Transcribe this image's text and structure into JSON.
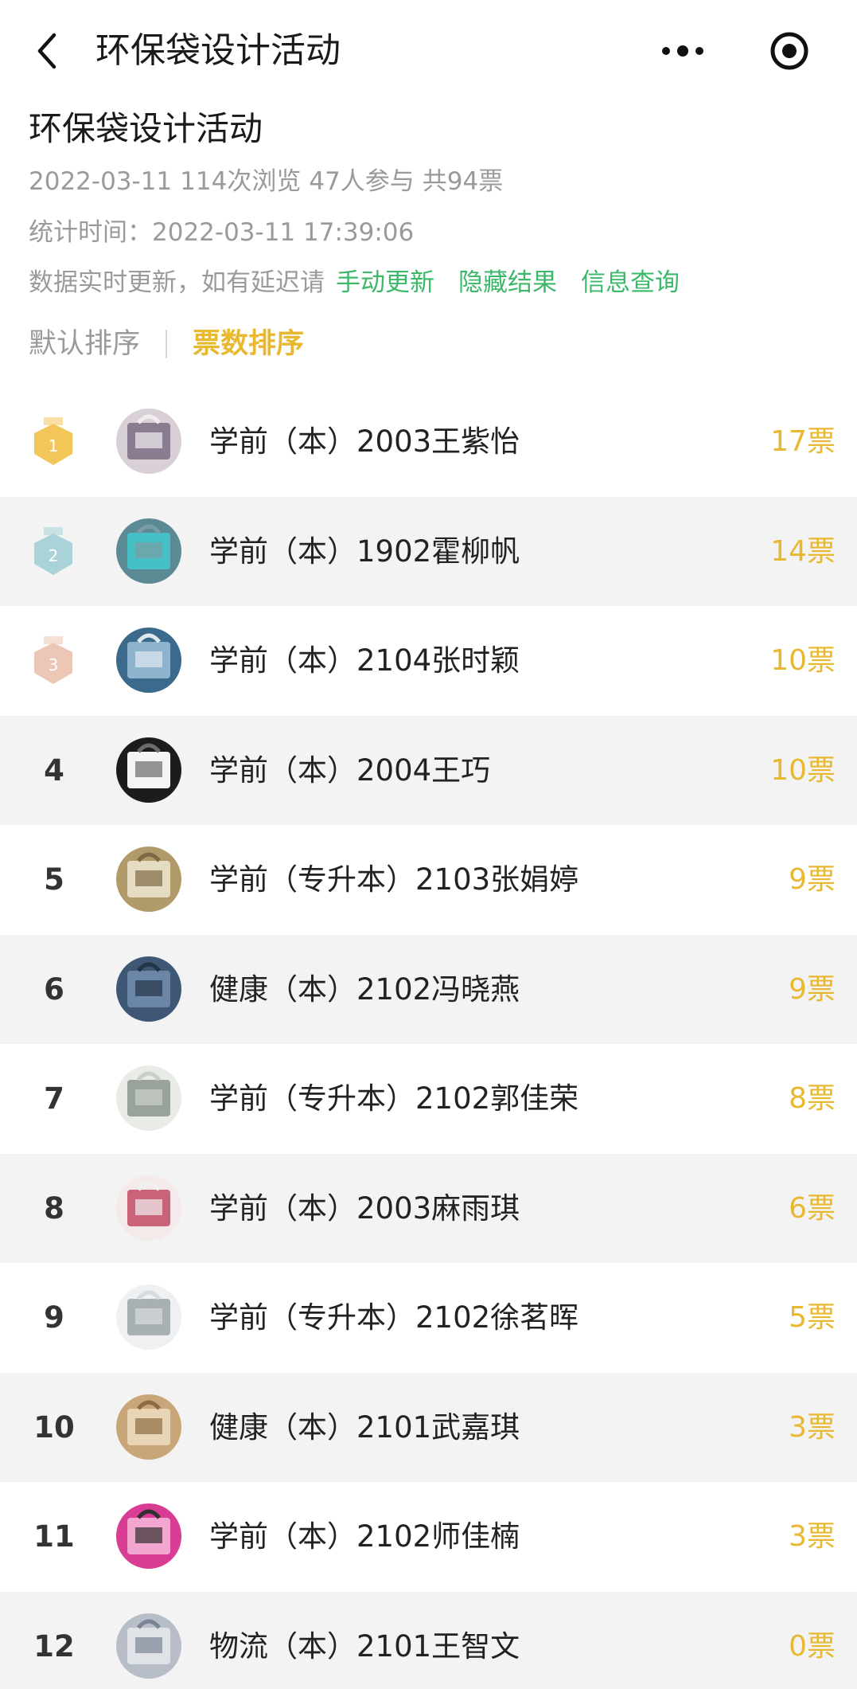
{
  "navbar": {
    "title": "环保袋设计活动",
    "back_icon": "back-chevron-icon",
    "more_icon": "more-dots-icon",
    "miniapp_icon": "target-circle-icon"
  },
  "activity": {
    "title": "环保袋设计活动",
    "date": "2022-03-11",
    "views": "114次浏览",
    "participants": "47人参与",
    "total_votes": "共94票",
    "stat_time": "统计时间：2022-03-11 17:39:06",
    "notice_text": "数据实时更新，如有延迟请",
    "links": {
      "refresh": "手动更新",
      "hide": "隐藏结果",
      "query": "信息查询"
    }
  },
  "sort": {
    "default_label": "默认排序",
    "votes_label": "票数排序"
  },
  "colors": {
    "accent": "#e8b830",
    "link": "#3db86a",
    "gold": "#f3c65a",
    "silver": "#a9d3d8",
    "bronze": "#ecc7b5"
  },
  "ranking": [
    {
      "rank": "1",
      "name": "学前（本）2003王紫怡",
      "votes": "17票",
      "medal": "gold"
    },
    {
      "rank": "2",
      "name": "学前（本）1902霍柳帆",
      "votes": "14票",
      "medal": "silver"
    },
    {
      "rank": "3",
      "name": "学前（本）2104张时颖",
      "votes": "10票",
      "medal": "bronze"
    },
    {
      "rank": "4",
      "name": "学前（本）2004王巧",
      "votes": "10票"
    },
    {
      "rank": "5",
      "name": "学前（专升本）2103张娟婷",
      "votes": "9票"
    },
    {
      "rank": "6",
      "name": "健康（本）2102冯晓燕",
      "votes": "9票"
    },
    {
      "rank": "7",
      "name": "学前（专升本）2102郭佳荣",
      "votes": "8票"
    },
    {
      "rank": "8",
      "name": "学前（本）2003麻雨琪",
      "votes": "6票"
    },
    {
      "rank": "9",
      "name": "学前（专升本）2102徐茗晖",
      "votes": "5票"
    },
    {
      "rank": "10",
      "name": "健康（本）2101武嘉琪",
      "votes": "3票"
    },
    {
      "rank": "11",
      "name": "学前（本）2102师佳楠",
      "votes": "3票"
    },
    {
      "rank": "12",
      "name": "物流（本）2101王智文",
      "votes": "0票"
    }
  ]
}
